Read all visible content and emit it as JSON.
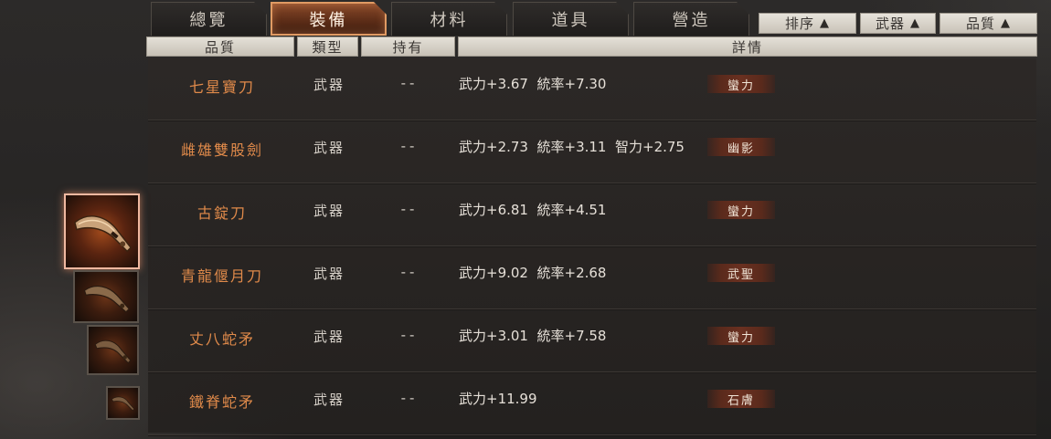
{
  "tabs": [
    {
      "label": "總覽",
      "active": false
    },
    {
      "label": "裝備",
      "active": true
    },
    {
      "label": "材料",
      "active": false
    },
    {
      "label": "道具",
      "active": false
    },
    {
      "label": "營造",
      "active": false
    }
  ],
  "filters": {
    "sort": {
      "label": "排序",
      "icon": "triangle-up-icon"
    },
    "category": {
      "label": "武器",
      "icon": "triangle-up-icon"
    },
    "quality": {
      "label": "品質",
      "icon": "triangle-up-icon"
    }
  },
  "columns": {
    "quality": "品質",
    "type": "類型",
    "held": "持有",
    "details": "詳情"
  },
  "items": [
    {
      "name": "七星寶刀",
      "type": "武器",
      "held": "--",
      "stats": "武力+3.67  統率+7.30",
      "skill": "蠻力"
    },
    {
      "name": "雌雄雙股劍",
      "type": "武器",
      "held": "--",
      "stats": "武力+2.73  統率+3.11  智力+2.75",
      "skill": "幽影"
    },
    {
      "name": "古錠刀",
      "type": "武器",
      "held": "--",
      "stats": "武力+6.81  統率+4.51",
      "skill": "蠻力"
    },
    {
      "name": "青龍偃月刀",
      "type": "武器",
      "held": "--",
      "stats": "武力+9.02  統率+2.68",
      "skill": "武聖"
    },
    {
      "name": "丈八蛇矛",
      "type": "武器",
      "held": "--",
      "stats": "武力+3.01  統率+7.58",
      "skill": "蠻力"
    },
    {
      "name": "鐵脊蛇矛",
      "type": "武器",
      "held": "--",
      "stats": "武力+11.99",
      "skill": "石膚"
    }
  ],
  "colors": {
    "item_name": "#e08a4a",
    "active_tab_border": "#e09a63",
    "badge_bg": "#6a3020"
  }
}
